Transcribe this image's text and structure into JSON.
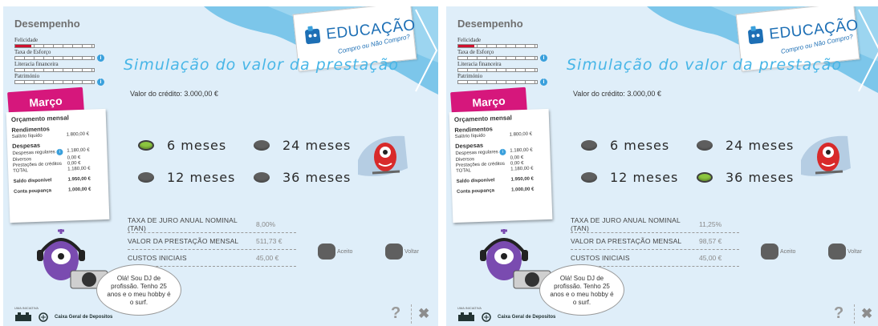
{
  "screens": [
    {
      "performance_title": "Desempenho",
      "metrics": [
        {
          "label": "Felicidade",
          "level": 0.2,
          "info": false
        },
        {
          "label": "Taxa de Esforço",
          "level": 0,
          "info": true
        },
        {
          "label": "Literacia financeira",
          "level": 0,
          "info": false
        },
        {
          "label": "Património",
          "level": 0,
          "info": true
        }
      ],
      "month": "Março",
      "budget": {
        "title": "Orçamento mensal",
        "income_title": "Rendimentos",
        "income_rows": [
          {
            "label": "Salário líquido",
            "value": "1.800,00 €"
          }
        ],
        "expense_title": "Despesas",
        "expense_rows": [
          {
            "label": "Despesas regulares",
            "value": "1.180,00 €"
          },
          {
            "label": "Diversos",
            "value": "0,00 €"
          },
          {
            "label": "Prestações de créditos",
            "value": "0,00 €"
          },
          {
            "label": "TOTAL",
            "value": "1.180,00 €"
          }
        ],
        "available_label": "Saldo disponível",
        "available_value": "1.950,00 €",
        "savings_label": "Conta poupança",
        "savings_value": "1.000,00 €"
      },
      "logo": {
        "word": "EDUCAÇÃO",
        "tagline": "Compro ou Não Compro?"
      },
      "title": "Simulação do valor da prestação",
      "credit_label": "Valor do crédito: 3.000,00 €",
      "options": [
        "6 meses",
        "24 meses",
        "12 meses",
        "36 meses"
      ],
      "selected_option": "6 meses",
      "table": [
        {
          "label": "TAXA DE JURO ANUAL NOMINAL (TAN)",
          "value": "8,00%"
        },
        {
          "label": "VALOR DA PRESTAÇÃO MENSAL",
          "value": "511,73 €"
        },
        {
          "label": "CUSTOS INICIAIS",
          "value": "45,00 €"
        }
      ],
      "accept_label": "Aceito",
      "back_label": "Voltar",
      "bubble_text": "Olá! Sou DJ de profissão. Tenho 25 anos e o meu hobby é o surf.",
      "sponsor_label": "UMA INICIATIVA",
      "sponsor_name": "Caixa Geral de Depositos",
      "help_glyph": "?",
      "close_glyph": "✖"
    },
    {
      "performance_title": "Desempenho",
      "metrics": [
        {
          "label": "Felicidade",
          "level": 0.2,
          "info": false
        },
        {
          "label": "Taxa de Esforço",
          "level": 0,
          "info": true
        },
        {
          "label": "Literacia financeira",
          "level": 0,
          "info": false
        },
        {
          "label": "Património",
          "level": 0,
          "info": true
        }
      ],
      "month": "Março",
      "budget": {
        "title": "Orçamento mensal",
        "income_title": "Rendimentos",
        "income_rows": [
          {
            "label": "Salário líquido",
            "value": "1.800,00 €"
          }
        ],
        "expense_title": "Despesas",
        "expense_rows": [
          {
            "label": "Despesas regulares",
            "value": "1.180,00 €"
          },
          {
            "label": "Diversos",
            "value": "0,00 €"
          },
          {
            "label": "Prestações de créditos",
            "value": "0,00 €"
          },
          {
            "label": "TOTAL",
            "value": "1.180,00 €"
          }
        ],
        "available_label": "Saldo disponível",
        "available_value": "1.950,00 €",
        "savings_label": "Conta poupança",
        "savings_value": "1.000,00 €"
      },
      "logo": {
        "word": "EDUCAÇÃO",
        "tagline": "Compro ou Não Compro?"
      },
      "title": "Simulação do valor da prestação",
      "credit_label": "Valor do crédito: 3.000,00 €",
      "options": [
        "6 meses",
        "24 meses",
        "12 meses",
        "36 meses"
      ],
      "selected_option": "36 meses",
      "table": [
        {
          "label": "TAXA DE JURO ANUAL NOMINAL (TAN)",
          "value": "11,25%"
        },
        {
          "label": "VALOR DA PRESTAÇÃO MENSAL",
          "value": "98,57 €"
        },
        {
          "label": "CUSTOS INICIAIS",
          "value": "45,00 €"
        }
      ],
      "accept_label": "Aceito",
      "back_label": "Voltar",
      "bubble_text": "Olá! Sou DJ de profissão. Tenho 25 anos e o meu hobby é o surf.",
      "sponsor_label": "UMA INICIATIVA",
      "sponsor_name": "Caixa Geral de Depositos",
      "help_glyph": "?",
      "close_glyph": "✖"
    }
  ]
}
